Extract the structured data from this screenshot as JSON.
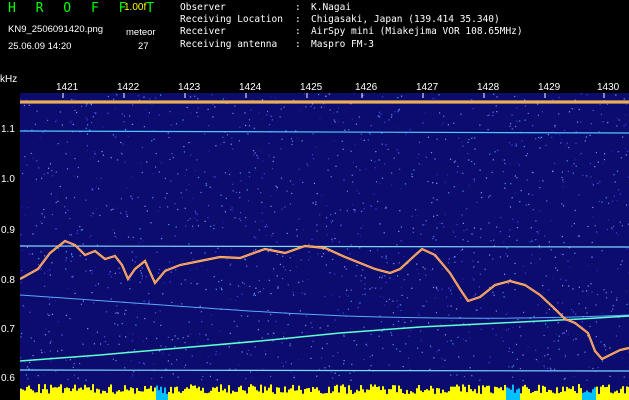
{
  "header": {
    "app_title": "H R O F F T",
    "version": "1.00f",
    "filename": "KN9_2506091420.png",
    "meteor_label": "meteor",
    "datetime": "25.06.09 14:20",
    "meteor_count": "27"
  },
  "station": [
    {
      "key": "Observer",
      "value": "K.Nagai"
    },
    {
      "key": "Receiving Location",
      "value": "Chigasaki, Japan (139.414 35.340)"
    },
    {
      "key": "Receiver",
      "value": "AirSpy mini (Miakejima VOR 108.65MHz)"
    },
    {
      "key": "Receiving antenna",
      "value": "Maspro FM-3"
    }
  ],
  "chart_data": {
    "type": "heatmap",
    "ylabel": "kHz",
    "x_ticks": [
      "1421",
      "1422",
      "1423",
      "1424",
      "1425",
      "1426",
      "1427",
      "1428",
      "1429",
      "1430"
    ],
    "y_ticks": [
      "1.1",
      "1.0",
      "0.9",
      "0.8",
      "0.7",
      "0.6"
    ],
    "ylim": [
      0.6,
      1.15
    ],
    "colors": {
      "background": "#0c0c6e",
      "band_yellow": "#ffff00",
      "band_cyan": "#00c8ff"
    }
  }
}
